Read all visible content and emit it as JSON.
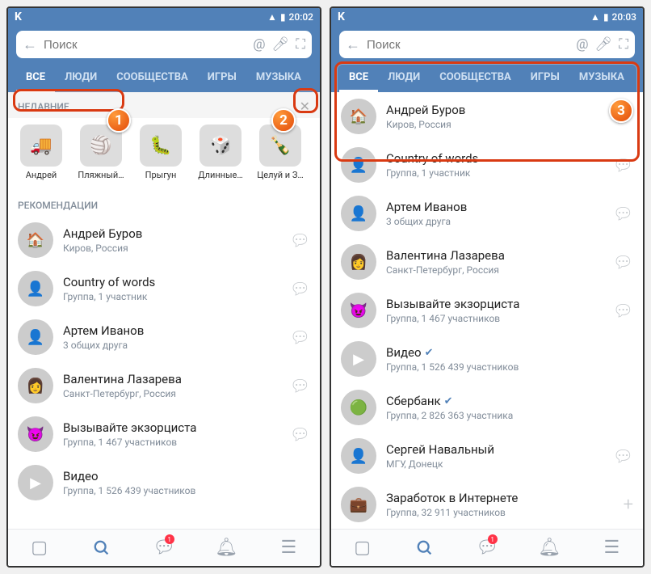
{
  "status": {
    "carrier": "K",
    "time": "20:02",
    "time2": "20:03"
  },
  "search": {
    "placeholder": "Поиск"
  },
  "tabs": {
    "all": "ВСЕ",
    "people": "ЛЮДИ",
    "groups": "СООБЩЕСТВА",
    "games": "ИГРЫ",
    "music": "МУЗЫКА"
  },
  "sections": {
    "recent": "НЕДАВНИЕ",
    "recs": "РЕКОМЕНДАЦИИ"
  },
  "recent": [
    {
      "label": "Андрей"
    },
    {
      "label": "Пляжный…"
    },
    {
      "label": "Прыгун"
    },
    {
      "label": "Длинные…"
    },
    {
      "label": "Целуй и З…"
    }
  ],
  "recs": [
    {
      "name": "Андрей Буров",
      "sub": "Киров, Россия"
    },
    {
      "name": "Country of words",
      "sub": "Группа, 1 участник"
    },
    {
      "name": "Артем Иванов",
      "sub": "3 общих друга"
    },
    {
      "name": "Валентина Лазарева",
      "sub": "Санкт-Петербург, Россия"
    },
    {
      "name": "Вызывайте экзорциста",
      "sub": "Группа, 1 467 участников"
    },
    {
      "name": "Видео",
      "sub": "Группа, 1 526 439 участников"
    }
  ],
  "right": [
    {
      "name": "Андрей Буров",
      "sub": "Киров, Россия",
      "chat": true
    },
    {
      "name": "Country of words",
      "sub": "Группа, 1 участник",
      "chat": true
    },
    {
      "name": "Артем Иванов",
      "sub": "3 общих друга",
      "chat": true
    },
    {
      "name": "Валентина Лазарева",
      "sub": "Санкт-Петербург, Россия",
      "chat": true
    },
    {
      "name": "Вызывайте экзорциста",
      "sub": "Группа, 1 467 участников",
      "chat": true
    },
    {
      "name": "Видео",
      "sub": "Группа, 1 526 439 участников",
      "verified": true
    },
    {
      "name": "Сбербанк",
      "sub": "Группа, 2 826 363 участника",
      "verified": true
    },
    {
      "name": "Сергей Навальный",
      "sub": "МГУ, Донецк",
      "chat": true
    },
    {
      "name": "Заработок в Интернете",
      "sub": "Группа, 32 911 участников",
      "plus": true
    }
  ],
  "callouts": {
    "n1": "1",
    "n2": "2",
    "n3": "3"
  },
  "nav_badge": "1"
}
